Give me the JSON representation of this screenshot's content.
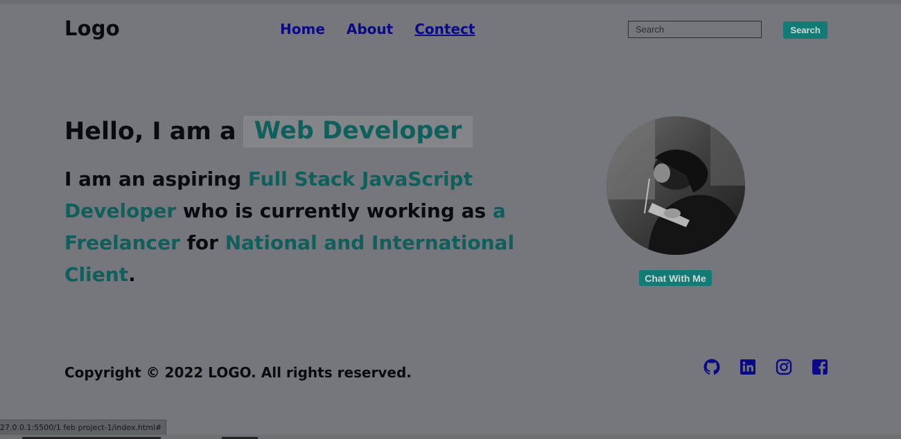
{
  "header": {
    "logo": "Logo",
    "nav": [
      {
        "label": "Home"
      },
      {
        "label": "About"
      },
      {
        "label": "Contect"
      }
    ],
    "search": {
      "placeholder": "Search",
      "value": "",
      "button_label": "Search"
    }
  },
  "hero": {
    "greeting": "Hello, I am a",
    "role": "Web Developer",
    "intro": {
      "p1": "I am an aspiring ",
      "h1": "Full Stack JavaScript Developer",
      "p2": " who is currently working as ",
      "h2": "a Freelancer",
      "p3": " for ",
      "h3": "National and International Client",
      "p4": "."
    },
    "chat_button": "Chat With Me"
  },
  "footer": {
    "copyright": "Copyright © 2022 LOGO. All rights reserved.",
    "social_icons": [
      "github-icon",
      "linkedin-icon",
      "instagram-icon",
      "facebook-icon"
    ]
  },
  "browser": {
    "status_url": "27.0.0.1:5500/1 feb project-1/index.html#"
  },
  "colors": {
    "background": "#75777c",
    "accent_teal": "#127b75",
    "highlight_text": "#0f5f5c",
    "nav_link": "#0a0a86",
    "social_icon": "#0a0a86"
  }
}
